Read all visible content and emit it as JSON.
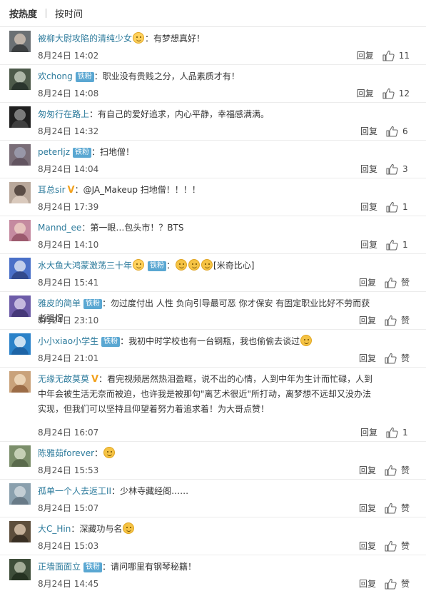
{
  "sort_tabs": [
    {
      "label": "按热度",
      "active": true
    },
    {
      "label": "按时间",
      "active": false
    }
  ],
  "reply_label": "回复",
  "comments": [
    {
      "user": "被柳大尉攻陷的清纯少女",
      "badge": "",
      "vip": false,
      "emoji_after_name": "love-face-emoji",
      "text": "：有梦想真好！",
      "time": "8月24日 14:02",
      "likes": "11",
      "avatar_colors": [
        "#6b7074",
        "#d9c8b9",
        "#2d3032"
      ]
    },
    {
      "user": "欢chong",
      "badge": "铁粉",
      "vip": false,
      "emoji_after_name": "",
      "text": "：职业没有贵贱之分，人品素质才有！",
      "time": "8月24日 14:08",
      "likes": "12",
      "avatar_colors": [
        "#4d5a4a",
        "#cfd7c8",
        "#1f2a24"
      ]
    },
    {
      "user": "匆匆行在路上",
      "badge": "",
      "vip": false,
      "emoji_after_name": "",
      "text": "：有自己的爱好追求，内心平静，幸福感满满。",
      "time": "8月24日 14:32",
      "likes": "6",
      "avatar_colors": [
        "#202020",
        "#9a9a9a",
        "#4a4a4a"
      ]
    },
    {
      "user": "peterljz",
      "badge": "铁粉",
      "vip": false,
      "emoji_after_name": "",
      "text": "：扫地僧！",
      "time": "8月24日 14:04",
      "likes": "3",
      "avatar_colors": [
        "#7a6e78",
        "#a3a6b8",
        "#5b4c58"
      ]
    },
    {
      "user": "耳总sir",
      "badge": "",
      "vip": true,
      "emoji_after_name": "",
      "text": "：@JA_Makeup 扫地僧！！！！",
      "time": "8月24日 17:39",
      "likes": "1",
      "avatar_colors": [
        "#b9a89b",
        "#3b2e28",
        "#e6d6c8"
      ]
    },
    {
      "user": "Mannd_ee",
      "badge": "",
      "vip": false,
      "emoji_after_name": "",
      "text": "：第一眼…包头市！？BTS",
      "time": "8月24日 14:10",
      "likes": "1",
      "avatar_colors": [
        "#c58aa0",
        "#f2d5c8",
        "#8d4a5e"
      ]
    },
    {
      "user": "水大鱼大鸿蒙激荡三十年",
      "badge": "铁粉",
      "vip": false,
      "emoji_after_name": "love-face-emoji",
      "text": "：",
      "text_emojis": 3,
      "text_tail": "[米奇比心]",
      "time": "8月24日 15:41",
      "likes": "赞",
      "avatar_colors": [
        "#4a70c8",
        "#e9eef7",
        "#2b3d7a"
      ]
    },
    {
      "user": "雅皮的简单",
      "badge": "铁粉",
      "vip": false,
      "emoji_after_name": "",
      "text": "：勿过度付出 人性 负向引导最可恶 你才保安 有固定职业比好不劳而获者强悍",
      "time": "8月24日 23:10",
      "likes": "赞",
      "avatar_colors": [
        "#6d5ca8",
        "#e3d8f0",
        "#3a2d6a"
      ]
    },
    {
      "user": "小小xiao小学生",
      "badge": "铁粉",
      "vip": false,
      "emoji_after_name": "",
      "text": "：我初中时学校也有一台钢瓶，我也偷偷去谈过",
      "text_emojis": 1,
      "time": "8月24日 21:01",
      "likes": "赞",
      "avatar_colors": [
        "#2a82c9",
        "#ffffff",
        "#1a5a9a"
      ]
    },
    {
      "user": "无缘无故莫莫",
      "badge": "",
      "vip": true,
      "emoji_after_name": "",
      "text": "：看完视频居然热泪盈眶，说不出的心情，人到中年为生计而忙碌，人到中年会被生活无奈而被迫，也许我是被那句\"离艺术很近\"所打动，离梦想不远却又没办法实现，但我们可以坚持且仰望着努力着追求着！为大哥点赞！",
      "time": "8月24日 16:07",
      "likes": "1",
      "avatar_colors": [
        "#c9a27a",
        "#f5e3c8",
        "#8c5a36"
      ]
    },
    {
      "user": "陈雅茹forever",
      "badge": "",
      "vip": false,
      "emoji_after_name": "",
      "text": "：",
      "text_emojis": 1,
      "time": "8月24日 15:53",
      "likes": "赞",
      "avatar_colors": [
        "#7c8f6b",
        "#dfe6cf",
        "#4f5e42"
      ]
    },
    {
      "user": "孤单一个人去返工II",
      "badge": "",
      "vip": false,
      "emoji_after_name": "",
      "text": "：少林寺藏经阁……",
      "time": "8月24日 15:07",
      "likes": "赞",
      "avatar_colors": [
        "#8aa0ae",
        "#d6dde2",
        "#5c6e7a"
      ]
    },
    {
      "user": "大C_Hin",
      "badge": "",
      "vip": false,
      "emoji_after_name": "",
      "text": "：深藏功与名",
      "text_emojis": 1,
      "time": "8月24日 15:03",
      "likes": "赞",
      "avatar_colors": [
        "#5d4e3c",
        "#e8d2b8",
        "#2e251b"
      ]
    },
    {
      "user": "正墙面面立",
      "badge": "铁粉",
      "vip": false,
      "emoji_after_name": "",
      "text": "：请问哪里有钢琴秘籍！",
      "time": "8月24日 14:45",
      "likes": "赞",
      "avatar_colors": [
        "#3f4e3a",
        "#c7ccb8",
        "#1e2a1a"
      ]
    }
  ]
}
